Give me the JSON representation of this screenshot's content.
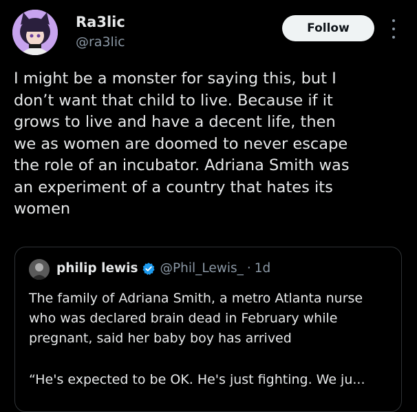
{
  "tweet": {
    "author": {
      "display_name": "Ra3lic",
      "handle": "@ra3lic",
      "avatar_icon": "anime-cat-girl-avatar"
    },
    "follow_label": "Follow",
    "more_icon": "more-options-icon",
    "text": "I might be a monster for saying this, but I\ndon’t want that child to live. Because if it\ngrows to live and have a decent life, then\nwe as women are doomed to never escape\nthe role of an incubator. Adriana Smith was\nan experiment of a country that hates its\nwomen"
  },
  "quote": {
    "author": {
      "display_name": "philip lewis",
      "handle": "@Phil_Lewis_",
      "separator": "·",
      "time": "1d",
      "verified_icon": "verified-badge-icon",
      "verified_color": "#1d9bf0"
    },
    "text": "The family of Adriana Smith, a metro Atlanta nurse\nwho was declared brain dead in February while\npregnant, said her baby boy has arrived",
    "snippet": "“He's expected to be OK. He's just fighting. We ju..."
  },
  "colors": {
    "background": "#000000",
    "primary_text": "#e7e9ea",
    "secondary_text": "#8b98a5",
    "button_bg": "#eff3f4",
    "border": "#2f3336"
  }
}
